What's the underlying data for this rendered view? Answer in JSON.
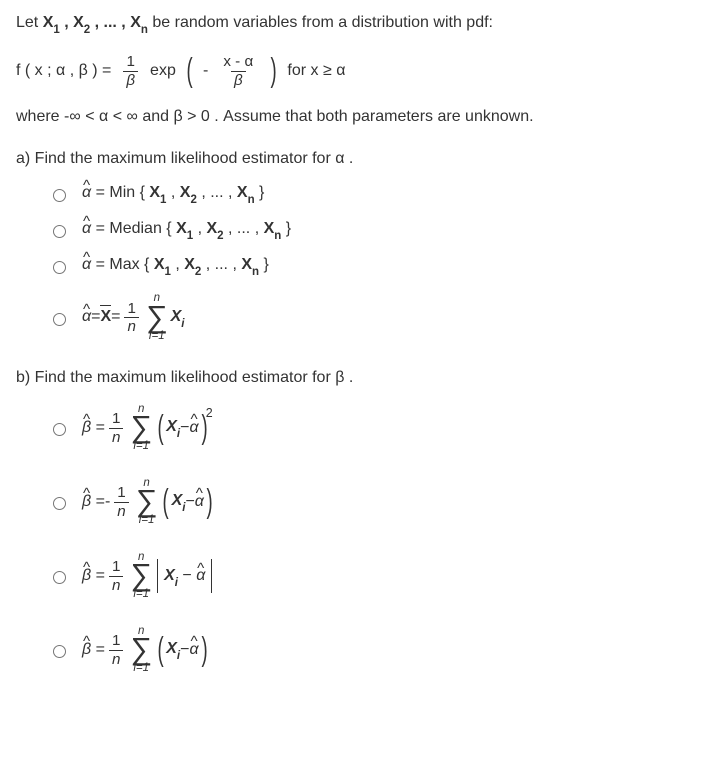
{
  "intro_prefix": "Let ",
  "vars_seq": "X₁ , X₂ , ... , Xₙ",
  "intro_suffix": " be random variables from a distribution with pdf:",
  "f_left": "f ( x ; α , β ) = ",
  "frac1_top": "1",
  "frac1_bot": "β",
  "exp": " exp ",
  "neg": " - ",
  "frac2_top": "x - α",
  "frac2_bot": "β",
  "for_x": " for x ≥ α",
  "where_prefix": "where  -∞ < α < ∞  and  β > 0 . Assume that both parameters are unknown.",
  "qa": "a) Find the maximum likelihood estimator for  α .",
  "a1": " = Min { X₁ , X₂ , ... , Xₙ }",
  "a2": " = Median { X₁ , X₂ , ... , Xₙ }",
  "a3": " = Max { X₁ , X₂ , ... , Xₙ }",
  "a4_eq": " = ",
  "a4_eq2": " = ",
  "sum_top": "n",
  "sum_bot": "i=1",
  "Xi": "Xᵢ",
  "frac_1n_top": "1",
  "frac_1n_bot": "n",
  "qb": "b) Find the maximum likelihood estimator for  β .",
  "sq2": "2",
  "minus": " − ",
  "negsign": " - ",
  "alpha_hat": "α",
  "beta_hat": "β",
  "Xbar": "X",
  "Xi_plain": "X",
  "i_sub": "i"
}
